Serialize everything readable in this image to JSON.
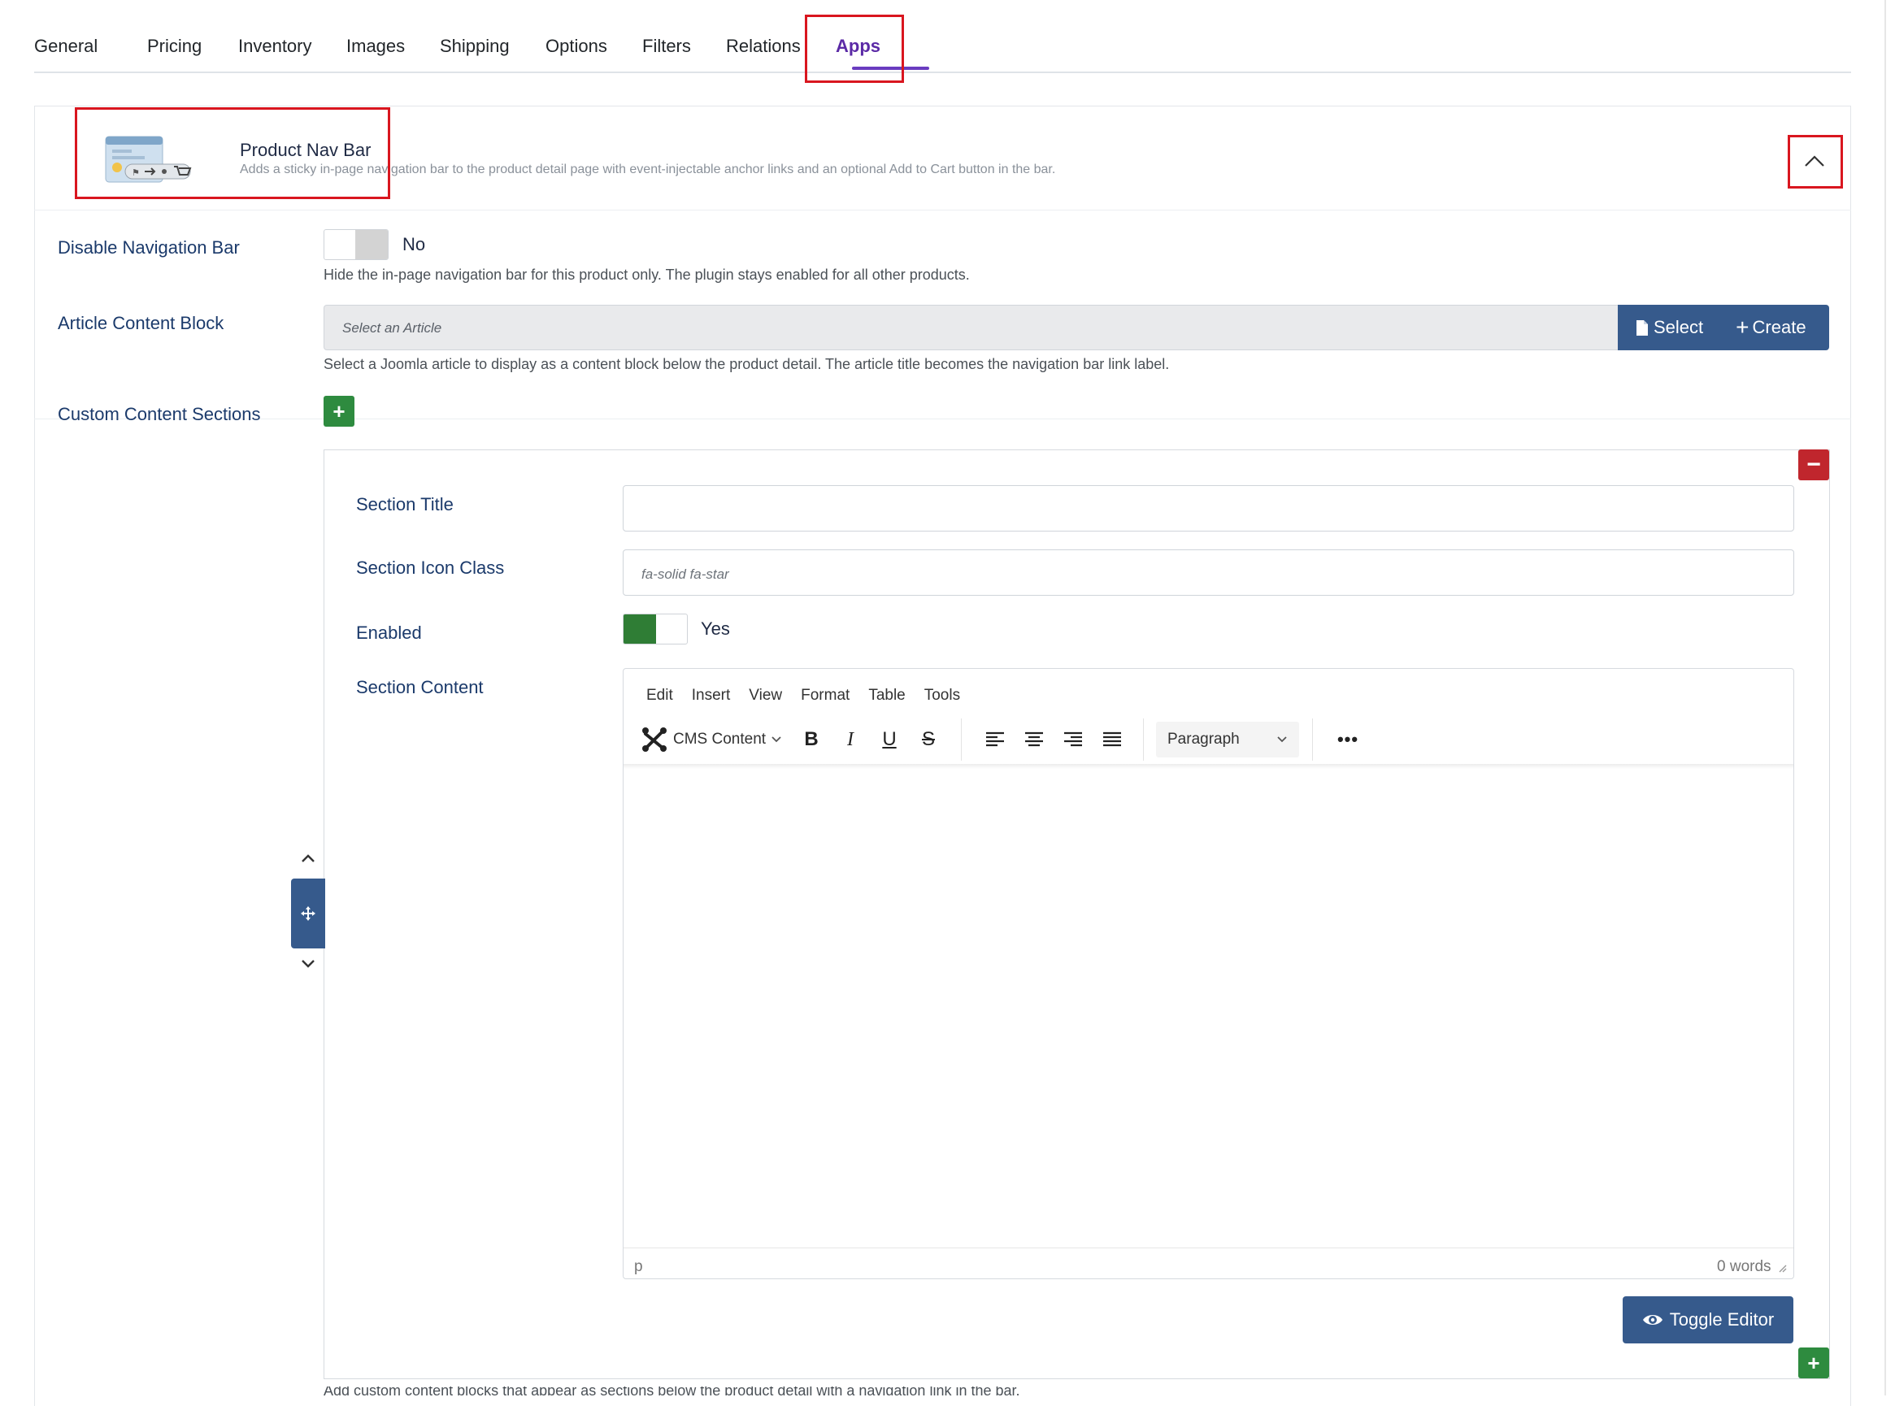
{
  "tabs": [
    {
      "label": "General"
    },
    {
      "label": "Pricing"
    },
    {
      "label": "Inventory"
    },
    {
      "label": "Images"
    },
    {
      "label": "Shipping"
    },
    {
      "label": "Options"
    },
    {
      "label": "Filters"
    },
    {
      "label": "Relations"
    },
    {
      "label": "Apps"
    }
  ],
  "active_tab": "Apps",
  "app": {
    "title": "Product Nav Bar",
    "description": "Adds a sticky in-page navigation bar to the product detail page with event-injectable anchor links and an optional Add to Cart button in the bar."
  },
  "disable_nav": {
    "label": "Disable Navigation Bar",
    "value": "No",
    "help": "Hide the in-page navigation bar for this product only. The plugin stays enabled for all other products."
  },
  "article_block": {
    "label": "Article Content Block",
    "placeholder": "Select an Article",
    "select_label": "Select",
    "create_label": "Create",
    "help": "Select a Joomla article to display as a content block below the product detail. The article title becomes the navigation bar link label."
  },
  "custom_sections": {
    "label": "Custom Content Sections",
    "help": "Add custom content blocks that appear as sections below the product detail with a navigation link in the bar.",
    "section": {
      "title_label": "Section Title",
      "title_value": "",
      "icon_label": "Section Icon Class",
      "icon_placeholder": "fa-solid fa-star",
      "enabled_label": "Enabled",
      "enabled_value": "Yes",
      "content_label": "Section Content"
    }
  },
  "editor": {
    "menu": [
      "Edit",
      "Insert",
      "View",
      "Format",
      "Table",
      "Tools"
    ],
    "cms_label": "CMS Content",
    "block_format": "Paragraph",
    "status_path": "p",
    "word_count": "0 words",
    "toggle_label": "Toggle Editor"
  },
  "colors": {
    "active_tab": "#5b2aa6",
    "highlight": "#d9161f",
    "primary_button": "#365a8c",
    "add_button": "#2e8b3f",
    "remove_button": "#c0262d",
    "toggle_on": "#2f7d35",
    "label_text": "#1b3a6b"
  }
}
